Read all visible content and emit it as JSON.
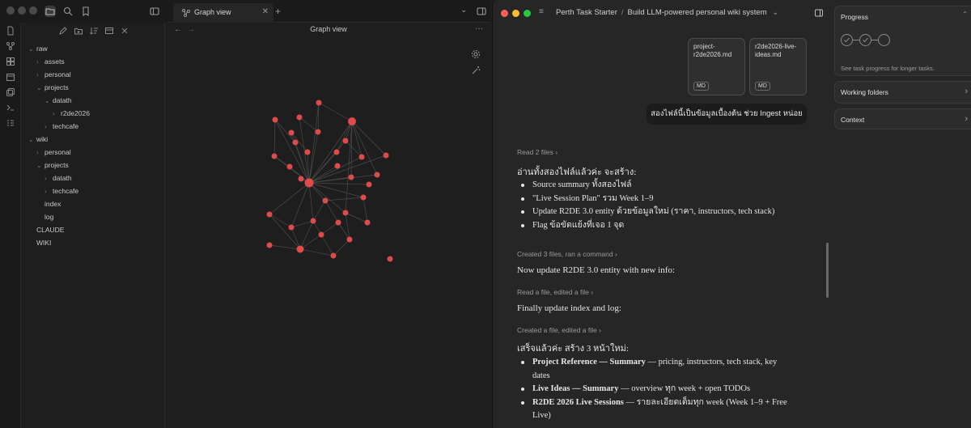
{
  "obsidian": {
    "tab_title": "Graph view",
    "pane_title": "Graph view",
    "tree": [
      {
        "label": "raw",
        "level": 0,
        "chev": "⌄"
      },
      {
        "label": "assets",
        "level": 1,
        "chev": "›"
      },
      {
        "label": "personal",
        "level": 1,
        "chev": "›"
      },
      {
        "label": "projects",
        "level": 1,
        "chev": "⌄"
      },
      {
        "label": "datath",
        "level": 2,
        "chev": "⌄"
      },
      {
        "label": "r2de2026",
        "level": 3,
        "chev": "›"
      },
      {
        "label": "techcafe",
        "level": 2,
        "chev": "›"
      },
      {
        "label": "wiki",
        "level": 0,
        "chev": "⌄"
      },
      {
        "label": "personal",
        "level": 1,
        "chev": "›"
      },
      {
        "label": "projects",
        "level": 1,
        "chev": "⌄"
      },
      {
        "label": "datath",
        "level": 2,
        "chev": "›"
      },
      {
        "label": "techcafe",
        "level": 2,
        "chev": "›"
      },
      {
        "label": "index",
        "level": 1,
        "chev": ""
      },
      {
        "label": "log",
        "level": 1,
        "chev": ""
      },
      {
        "label": "CLAUDE",
        "level": 0,
        "chev": ""
      },
      {
        "label": "WIKI",
        "level": 0,
        "chev": ""
      }
    ],
    "graph_color": "#e04a4a"
  },
  "claude": {
    "breadcrumb": {
      "project": "Perth Task Starter",
      "separator": "/",
      "chat": "Build LLM-powered personal wiki system"
    },
    "attachments": [
      {
        "name": "project-r2de2026.md",
        "badge": "MD"
      },
      {
        "name": "r2de2026-live-ideas.md",
        "badge": "MD"
      }
    ],
    "user_message": "สองไฟล์นี้เป็นข้อมูลเบื้องต้น ช่วย Ingest หน่อย",
    "steps": {
      "read_files": "Read 2 files",
      "created_files": "Created 3 files, ran a command",
      "read_edit": "Read a file, edited a file",
      "created_edit": "Created a file, edited a file"
    },
    "text": {
      "intro": "อ่านทั้งสองไฟล์แล้วค่ะ จะสร้าง:",
      "update_entity": "Now update R2DE 3.0 entity with new info:",
      "finally": "Finally update index and log:",
      "done": "เสร็จแล้วค่ะ สร้าง 3 หน้าใหม่:"
    },
    "plan_bullets": [
      "Source summary ทั้งสองไฟล์",
      "\"Live Session Plan\" รวม Week 1–9",
      "Update R2DE 3.0 entity ด้วยข้อมูลใหม่ (ราคา, instructors, tech stack)",
      "Flag ข้อขัดแย้งที่เจอ 1 จุด"
    ],
    "result_bullets": [
      {
        "bold": "Project Reference — Summary",
        "rest": " — pricing, instructors, tech stack, key",
        "rest2": "dates"
      },
      {
        "bold": "Live Ideas — Summary",
        "rest": " — overview ทุก week + open TODOs",
        "rest2": ""
      },
      {
        "bold": "R2DE 2026 Live Sessions",
        "rest": " — รายละเอียดเต็มทุก week (Week 1–9 + Free",
        "rest2": "Live)"
      }
    ],
    "panel": {
      "progress_title": "Progress",
      "progress_hint": "See task progress for longer tasks.",
      "working_folders": "Working folders",
      "context": "Context"
    }
  }
}
